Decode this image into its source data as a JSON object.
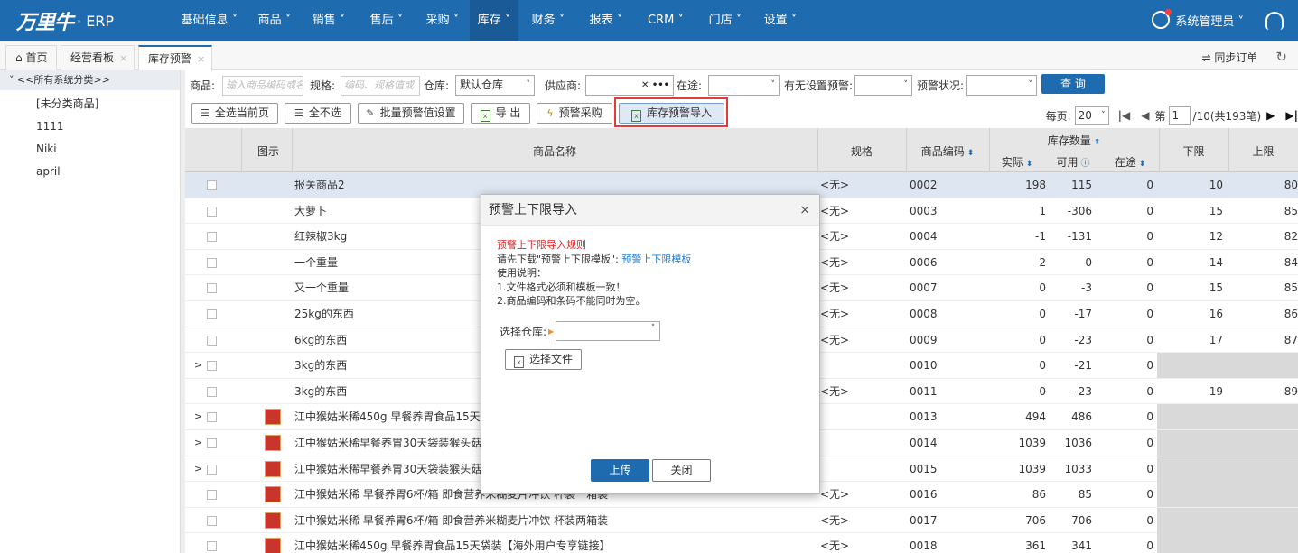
{
  "app": {
    "logo_text": "万里牛",
    "logo_suffix": "· ERP"
  },
  "nav": {
    "items": [
      {
        "label": "基础信息 ˅"
      },
      {
        "label": "商品 ˅"
      },
      {
        "label": "销售 ˅"
      },
      {
        "label": "售后 ˅"
      },
      {
        "label": "采购 ˅"
      },
      {
        "label": "库存 ˅"
      },
      {
        "label": "财务 ˅"
      },
      {
        "label": "报表 ˅"
      },
      {
        "label": "CRM ˅"
      },
      {
        "label": "门店 ˅"
      },
      {
        "label": "设置 ˅"
      }
    ],
    "active_index": 5,
    "user": "系统管理员 ˅"
  },
  "tabs": [
    {
      "label": "首页",
      "icon": "home-icon"
    },
    {
      "label": "经营看板",
      "close": "×"
    },
    {
      "label": "库存预警",
      "close": "×"
    }
  ],
  "tabbar_right": {
    "sync": "同步订单"
  },
  "sidebar": {
    "root": "˅ <<所有系统分类>>",
    "items": [
      "[未分类商品]",
      "1111",
      "Niki",
      "april"
    ]
  },
  "filter": {
    "product_label": "商品:",
    "product_placeholder": "输入商品编码或名",
    "spec_label": "规格:",
    "spec_placeholder": "编码、规格值或",
    "warehouse_label": "仓库:",
    "warehouse_value": "默认仓库",
    "supplier_label": "供应商:",
    "supplier_clear": "✕ •••",
    "transit_label": "在途:",
    "has_warning_label": "有无设置预警:",
    "warning_status_label": "预警状况:",
    "query_button": "查 询"
  },
  "toolbar": {
    "select_page": "全选当前页",
    "unselect_all": "全不选",
    "batch_set": "批量预警值设置",
    "export": "导 出",
    "warn_purchase": "预警采购",
    "import": "库存预警导入"
  },
  "pager": {
    "per_page_label": "每页:",
    "per_page": "20",
    "page_prefix": "第",
    "page": "1",
    "page_suffix": "/10(共193笔)"
  },
  "grid": {
    "headers": {
      "image": "图示",
      "name": "商品名称",
      "spec": "规格",
      "code": "商品编码",
      "stock": "库存数量",
      "actual": "实际",
      "available": "可用",
      "transit": "在途",
      "lower": "下限",
      "upper": "上限"
    },
    "rows": [
      {
        "expand": "",
        "name": "报关商品2",
        "spec": "<无>",
        "code": "0002",
        "actual": "198",
        "available": "115",
        "transit": "0",
        "lower": "10",
        "upper": "80"
      },
      {
        "expand": "",
        "name": "大萝卜",
        "spec": "<无>",
        "code": "0003",
        "actual": "1",
        "available": "-306",
        "transit": "0",
        "lower": "15",
        "upper": "85"
      },
      {
        "expand": "",
        "name": "红辣椒3kg",
        "spec": "<无>",
        "code": "0004",
        "actual": "-1",
        "available": "-131",
        "transit": "0",
        "lower": "12",
        "upper": "82"
      },
      {
        "expand": "",
        "name": "一个重量",
        "spec": "<无>",
        "code": "0006",
        "actual": "2",
        "available": "0",
        "transit": "0",
        "lower": "14",
        "upper": "84"
      },
      {
        "expand": "",
        "name": "又一个重量",
        "spec": "<无>",
        "code": "0007",
        "actual": "0",
        "available": "-3",
        "transit": "0",
        "lower": "15",
        "upper": "85"
      },
      {
        "expand": "",
        "name": "25kg的东西",
        "spec": "<无>",
        "code": "0008",
        "actual": "0",
        "available": "-17",
        "transit": "0",
        "lower": "16",
        "upper": "86"
      },
      {
        "expand": "",
        "name": "6kg的东西",
        "spec": "<无>",
        "code": "0009",
        "actual": "0",
        "available": "-23",
        "transit": "0",
        "lower": "17",
        "upper": "87"
      },
      {
        "expand": ">",
        "name": "3kg的东西",
        "spec": "",
        "code": "0010",
        "actual": "0",
        "available": "-21",
        "transit": "0",
        "lower": "",
        "upper": ""
      },
      {
        "expand": "",
        "name": "3kg的东西",
        "spec": "<无>",
        "code": "0011",
        "actual": "0",
        "available": "-23",
        "transit": "0",
        "lower": "19",
        "upper": "89"
      },
      {
        "expand": ">",
        "name": "江中猴姑米稀450g 早餐养胃食品15天袋装",
        "spec": "",
        "code": "0013",
        "actual": "494",
        "available": "486",
        "transit": "0",
        "lower": "",
        "upper": ""
      },
      {
        "expand": ">",
        "name": "江中猴姑米稀早餐养胃30天袋装猴头菇牌",
        "spec": "",
        "code": "0014",
        "actual": "1039",
        "available": "1036",
        "transit": "0",
        "lower": "",
        "upper": ""
      },
      {
        "expand": ">",
        "name": "江中猴姑米稀早餐养胃30天袋装猴头菇牌",
        "spec": "",
        "code": "0015",
        "actual": "1039",
        "available": "1033",
        "transit": "0",
        "lower": "",
        "upper": ""
      },
      {
        "expand": "",
        "name": "江中猴姑米稀 早餐养胃6杯/箱 即食营养米糊麦片冲饮 杯装一箱装",
        "spec": "<无>",
        "code": "0016",
        "actual": "86",
        "available": "85",
        "transit": "0",
        "lower": "",
        "upper": ""
      },
      {
        "expand": "",
        "name": "江中猴姑米稀 早餐养胃6杯/箱 即食营养米糊麦片冲饮 杯装两箱装",
        "spec": "<无>",
        "code": "0017",
        "actual": "706",
        "available": "706",
        "transit": "0",
        "lower": "",
        "upper": ""
      },
      {
        "expand": "",
        "name": "江中猴姑米稀450g 早餐养胃食品15天袋装【海外用户专享链接】",
        "spec": "<无>",
        "code": "0018",
        "actual": "361",
        "available": "341",
        "transit": "0",
        "lower": "",
        "upper": ""
      }
    ]
  },
  "modal": {
    "title": "预警上下限导入",
    "close": "×",
    "rule_title": "预警上下限导入规则",
    "download_text": "请先下载\"预警上下限模板\":",
    "template_link": "预警上下限模板",
    "usage": "使用说明：",
    "rule1": "1.文件格式必须和模板一致！",
    "rule2": "2.商品编码和条码不能同时为空。",
    "warehouse_label": "选择仓库:",
    "choose_file": "选择文件",
    "upload": "上传",
    "close_button": "关闭"
  }
}
